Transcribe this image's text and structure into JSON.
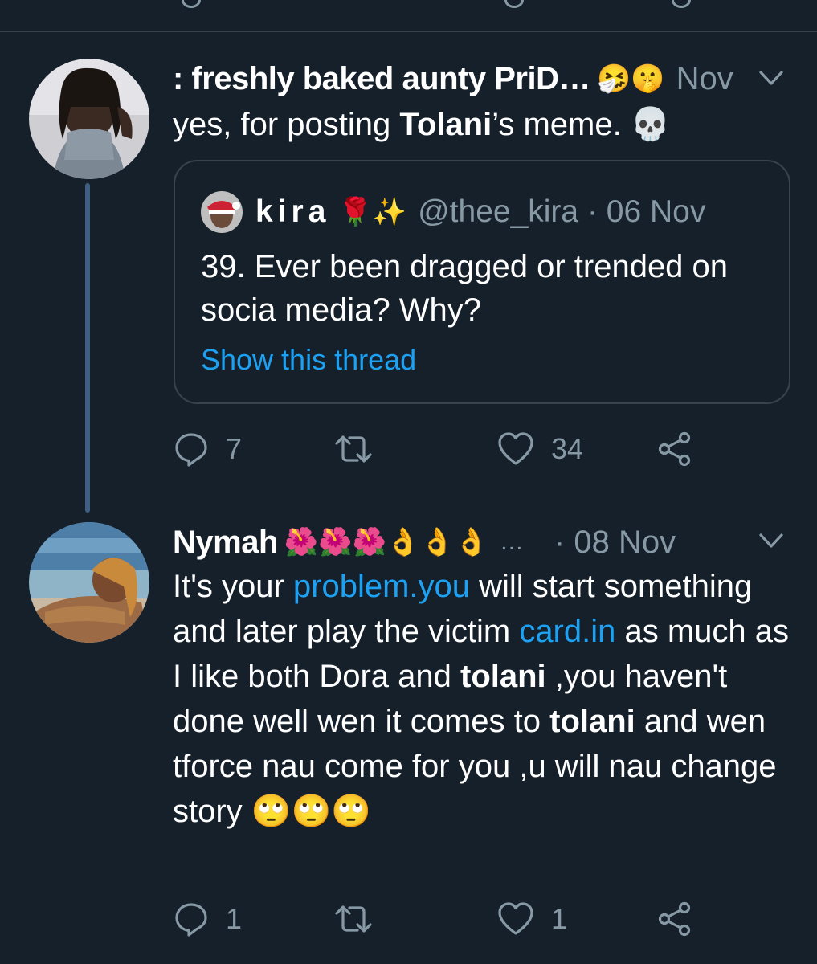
{
  "colors": {
    "background": "#15202b",
    "text_primary": "#ffffff",
    "text_secondary": "#8899a6",
    "link": "#1da1f2",
    "border": "#38444d",
    "thread_line": "#3f5f82"
  },
  "tweets": [
    {
      "display_name": ": freshly baked aunty PriD…",
      "name_emojis": "🤧🤫",
      "date": "Nov",
      "text_parts": [
        "yes, for posting ",
        "Tolani",
        "’s meme. 💀"
      ],
      "quote": {
        "display_name": "kira",
        "name_emojis": "🌹✨",
        "handle_date": "@thee_kira · 06 Nov",
        "text": "39. Ever been dragged or trended on socia media? Why?",
        "show_thread": "Show this thread"
      },
      "actions": {
        "reply_count": "7",
        "retweet_count": "",
        "like_count": "34"
      },
      "icons": [
        "reply-icon",
        "retweet-icon",
        "heart-icon",
        "share-icon",
        "chevron-down-icon"
      ]
    },
    {
      "display_name": "Nymah",
      "name_emojis": "🌺🌺🌺👌👌👌",
      "ellipsis": "…",
      "date": "· 08 Nov",
      "text_parts": [
        "It's your ",
        "problem.you",
        " will start something and later play the victim ",
        "card.in",
        " as much as I like both Dora and ",
        "tolani",
        " ,you haven't done well wen it comes to ",
        "tolani",
        " and wen tforce nau come for you ,u will nau change story 🙄🙄🙄"
      ],
      "actions": {
        "reply_count": "1",
        "retweet_count": "",
        "like_count": "1"
      },
      "icons": [
        "reply-icon",
        "retweet-icon",
        "heart-icon",
        "share-icon",
        "chevron-down-icon"
      ]
    }
  ]
}
